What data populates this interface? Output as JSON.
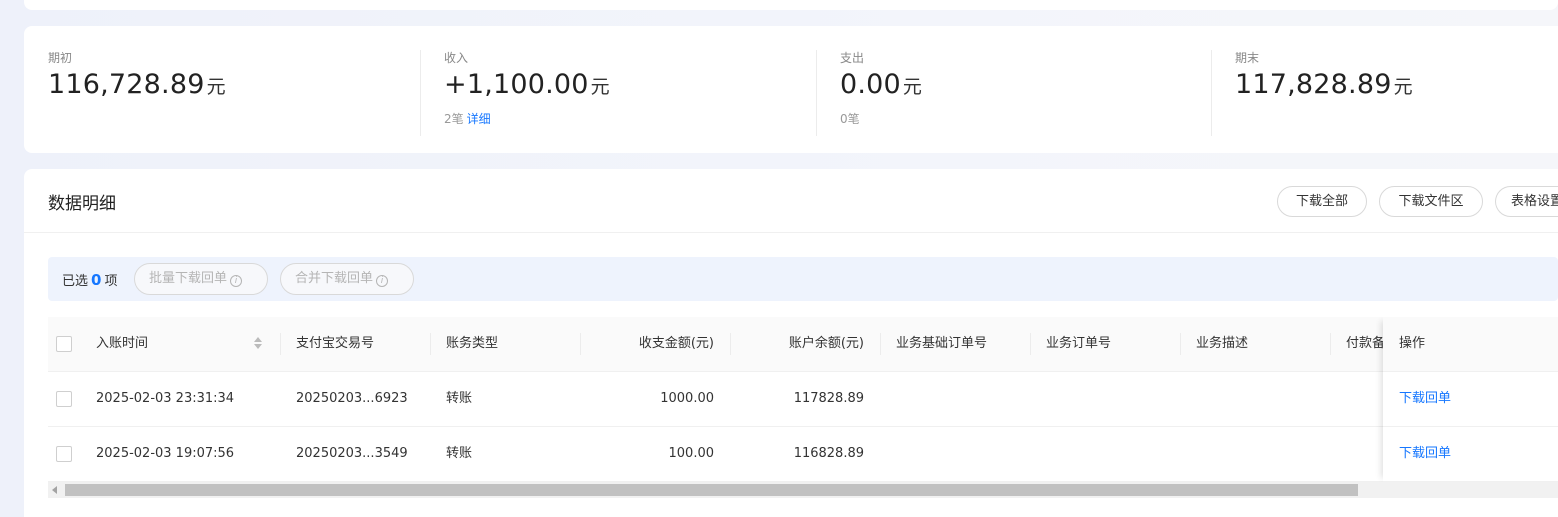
{
  "summary": {
    "opening": {
      "label": "期初",
      "value": "116,728.89",
      "unit": "元"
    },
    "income": {
      "label": "收入",
      "value": "+1,100.00",
      "unit": "元",
      "count": "2笔",
      "detail_link": "详细"
    },
    "expense": {
      "label": "支出",
      "value": "0.00",
      "unit": "元",
      "count": "0笔"
    },
    "closing": {
      "label": "期末",
      "value": "117,828.89",
      "unit": "元"
    }
  },
  "detail": {
    "title": "数据明细",
    "buttons": {
      "download_all": "下载全部",
      "download_files": "下载文件区",
      "table_settings": "表格设置"
    }
  },
  "selection": {
    "prefix": "已选",
    "count": "0",
    "suffix": "项",
    "batch_download": "批量下载回单",
    "merge_download": "合并下载回单"
  },
  "table": {
    "columns": [
      "入账时间",
      "支付宝交易号",
      "账务类型",
      "收支金额(元)",
      "账户余额(元)",
      "业务基础订单号",
      "业务订单号",
      "业务描述",
      "付款备注"
    ],
    "operation_header": "操作",
    "rows": [
      {
        "time": "2025-02-03 23:31:34",
        "trade_no": "20250203...6923",
        "type": "转账",
        "amount": "1000.00",
        "balance": "117828.89",
        "action": "下载回单"
      },
      {
        "time": "2025-02-03 19:07:56",
        "trade_no": "20250203...3549",
        "type": "转账",
        "amount": "100.00",
        "balance": "116828.89",
        "action": "下载回单"
      }
    ]
  },
  "colors": {
    "accent": "#1677ff",
    "border": "#d9d9d9",
    "selection_bg": "#eef3fd"
  }
}
